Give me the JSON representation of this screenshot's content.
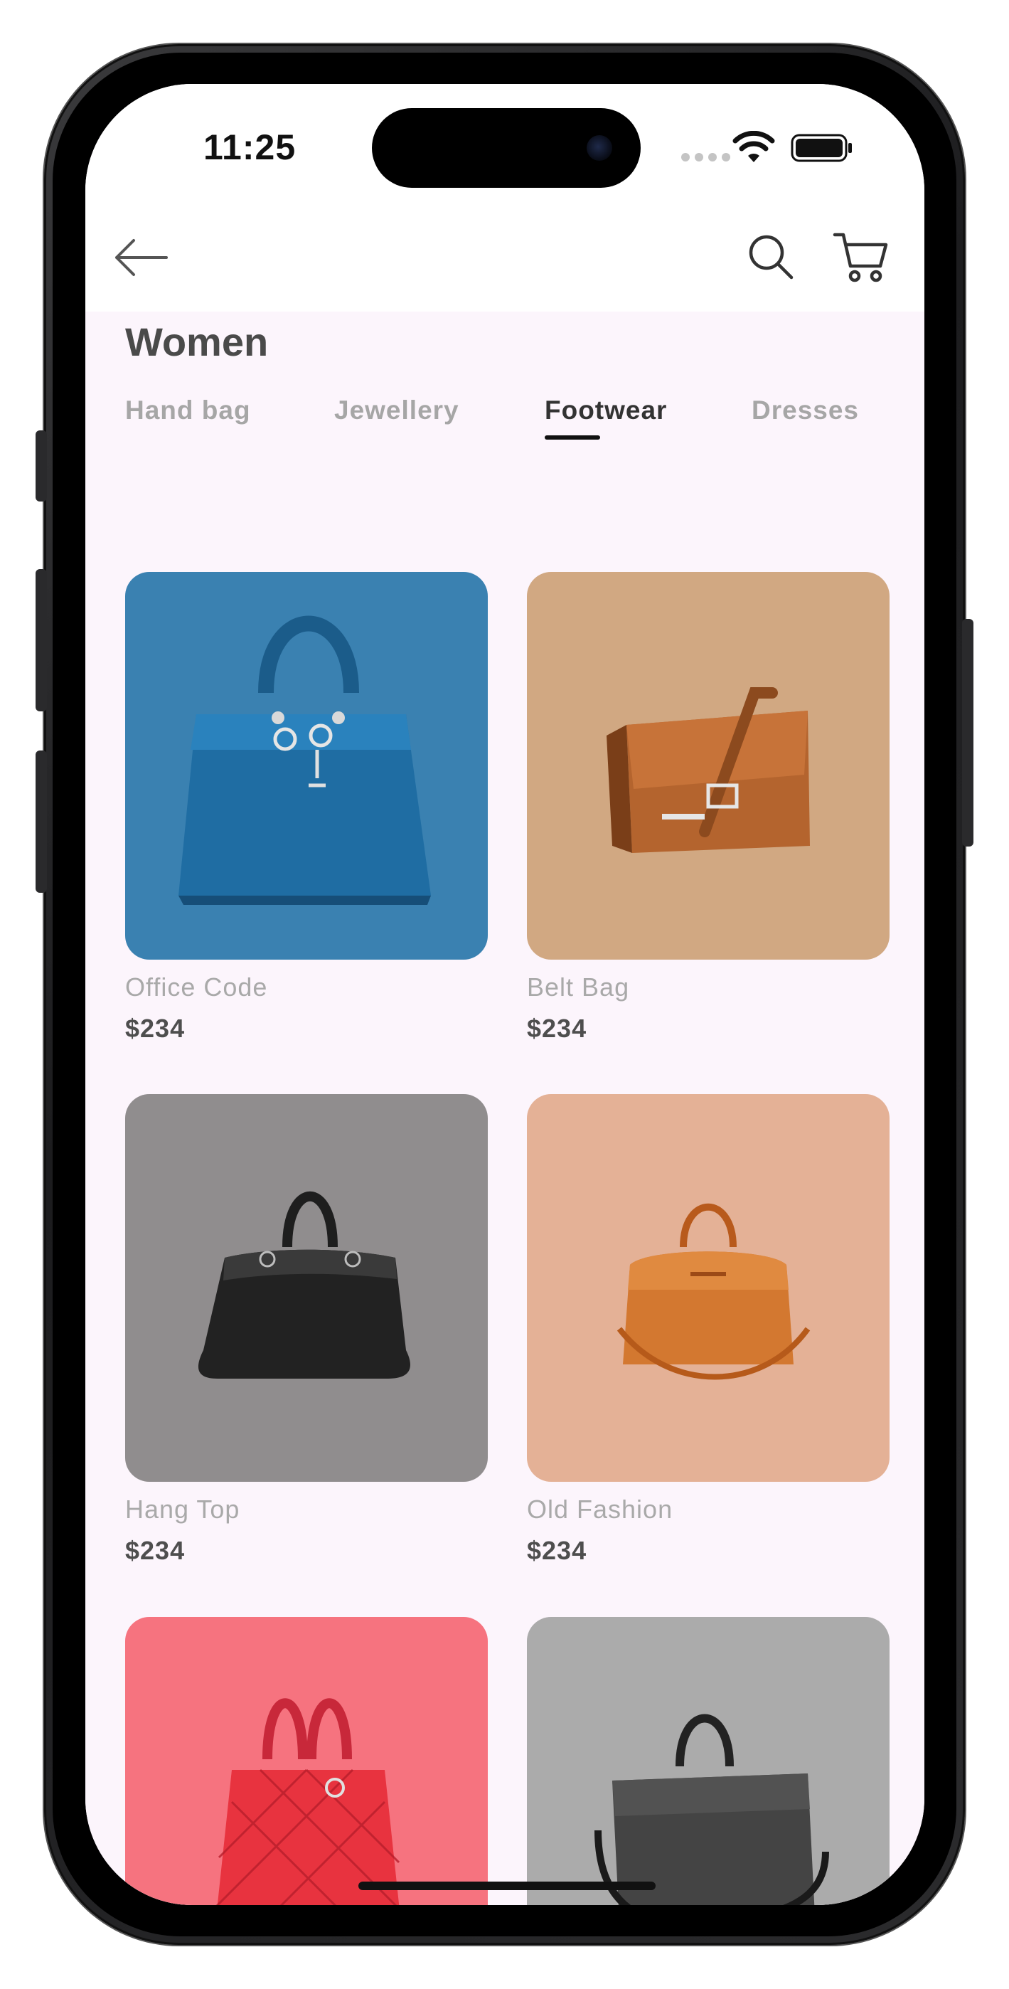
{
  "status_bar": {
    "time": "11:25",
    "icons": [
      "cellular-dots-icon",
      "wifi-icon",
      "battery-icon"
    ]
  },
  "header": {
    "icons": [
      "back-arrow-icon",
      "search-icon",
      "cart-icon"
    ]
  },
  "page": {
    "title": "Women"
  },
  "tabs": [
    {
      "label": "Hand bag",
      "active": false
    },
    {
      "label": "Jewellery",
      "active": false
    },
    {
      "label": "Footwear",
      "active": true
    },
    {
      "label": "Dresses",
      "active": false
    }
  ],
  "products": [
    {
      "name": "Office Code",
      "price": "$234",
      "bg_color": "#3a81b1",
      "image": "blue-handbag-image"
    },
    {
      "name": "Belt Bag",
      "price": "$234",
      "bg_color": "#d1a882",
      "image": "brown-messenger-bag-image"
    },
    {
      "name": "Hang Top",
      "price": "$234",
      "bg_color": "#908d8e",
      "image": "black-hobo-bag-image"
    },
    {
      "name": "Old Fashion",
      "price": "$234",
      "bg_color": "#e4b196",
      "image": "tan-duffel-bag-image"
    },
    {
      "name": "",
      "price": "",
      "bg_color": "#f6737f",
      "image": "red-quilted-handbag-image"
    },
    {
      "name": "",
      "price": "",
      "bg_color": "#ababab",
      "image": "grey-laptop-bag-image"
    }
  ],
  "colors": {
    "screen_bg": "#fcf5fc",
    "active_tab": "#333333",
    "inactive_tab": "#a6a6a6"
  }
}
